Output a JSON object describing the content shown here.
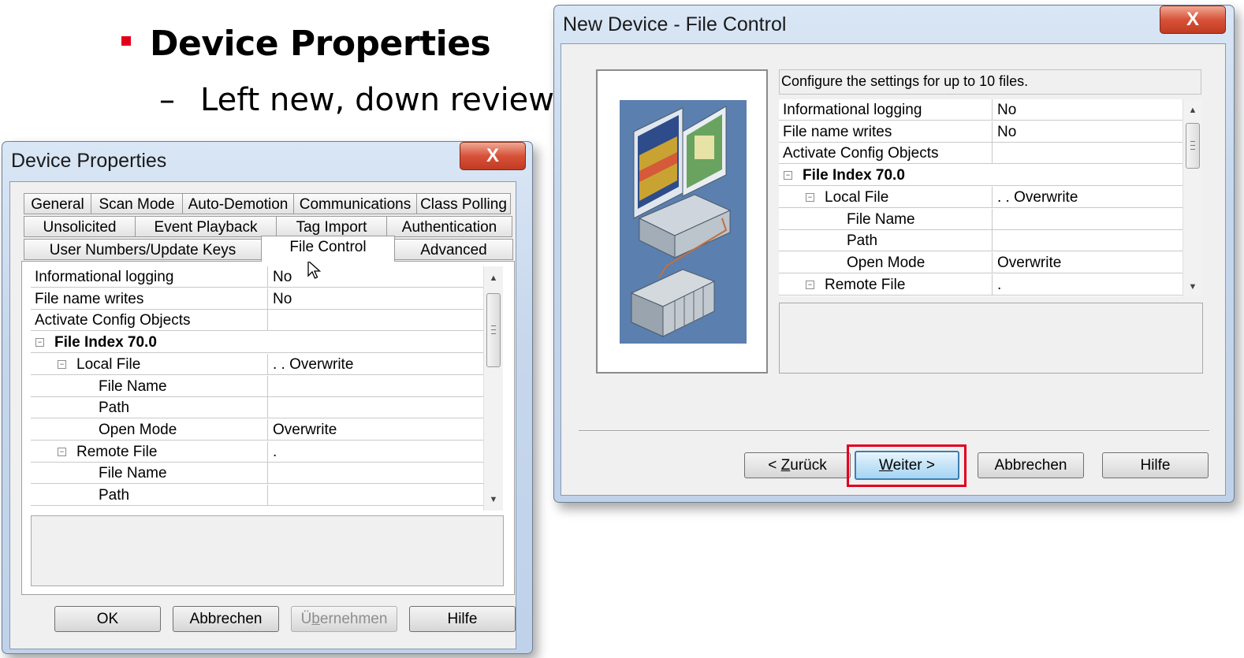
{
  "slide": {
    "title": "Device Properties",
    "dash": "–",
    "subtitle": "Left new, down review"
  },
  "colors": {
    "bullet": "#e3001b",
    "highlight": "#e0001b",
    "close_button": "#d8523a",
    "window_frame": "#c6d7ec"
  },
  "device_properties": {
    "title": "Device Properties",
    "close_glyph": "X",
    "tabs_row1": [
      "General",
      "Scan Mode",
      "Auto-Demotion",
      "Communications",
      "Class Polling"
    ],
    "tabs_row2": [
      "Unsolicited",
      "Event Playback",
      "Tag Import",
      "Authentication"
    ],
    "tabs_row3": [
      "User Numbers/Update Keys",
      "File Control",
      "Advanced"
    ],
    "active_tab": "File Control",
    "rows": [
      {
        "name": "Informational logging",
        "value": "No",
        "level": 0,
        "bold": false,
        "expander": false
      },
      {
        "name": "File name writes",
        "value": "No",
        "level": 0,
        "bold": false,
        "expander": false
      },
      {
        "name": "Activate Config Objects",
        "value": "",
        "level": 0,
        "bold": false,
        "expander": false
      },
      {
        "name": "File Index 70.0",
        "value": "",
        "level": 0,
        "bold": true,
        "expander": true
      },
      {
        "name": "Local File",
        "value": ". . Overwrite",
        "level": 1,
        "bold": false,
        "expander": true
      },
      {
        "name": "File Name",
        "value": "",
        "level": 2,
        "bold": false,
        "expander": false
      },
      {
        "name": "Path",
        "value": "",
        "level": 2,
        "bold": false,
        "expander": false
      },
      {
        "name": "Open Mode",
        "value": "Overwrite",
        "level": 2,
        "bold": false,
        "expander": false
      },
      {
        "name": "Remote File",
        "value": ".",
        "level": 1,
        "bold": false,
        "expander": true
      },
      {
        "name": "File Name",
        "value": "",
        "level": 2,
        "bold": false,
        "expander": false
      },
      {
        "name": "Path",
        "value": "",
        "level": 2,
        "bold": false,
        "expander": false
      }
    ],
    "buttons": {
      "ok": "OK",
      "cancel": "Abbrechen",
      "apply": "Übernehmen",
      "help": "Hilfe"
    }
  },
  "new_device": {
    "title": "New Device - File Control",
    "close_glyph": "X",
    "description": "Configure the settings for up to 10 files.",
    "illustration": "computer-and-plc-illustration",
    "rows": [
      {
        "name": "Informational logging",
        "value": "No",
        "level": 0,
        "bold": false,
        "expander": false
      },
      {
        "name": "File name writes",
        "value": "No",
        "level": 0,
        "bold": false,
        "expander": false
      },
      {
        "name": "Activate Config Objects",
        "value": "",
        "level": 0,
        "bold": false,
        "expander": false
      },
      {
        "name": "File Index 70.0",
        "value": "",
        "level": 0,
        "bold": true,
        "expander": true
      },
      {
        "name": "Local File",
        "value": ". . Overwrite",
        "level": 1,
        "bold": false,
        "expander": true
      },
      {
        "name": "File Name",
        "value": "",
        "level": 2,
        "bold": false,
        "expander": false
      },
      {
        "name": "Path",
        "value": "",
        "level": 2,
        "bold": false,
        "expander": false
      },
      {
        "name": "Open Mode",
        "value": "Overwrite",
        "level": 2,
        "bold": false,
        "expander": false
      },
      {
        "name": "Remote File",
        "value": ".",
        "level": 1,
        "bold": false,
        "expander": true
      }
    ],
    "buttons": {
      "back": "< Zurück",
      "next": "Weiter >",
      "cancel": "Abbrechen",
      "help": "Hilfe"
    }
  }
}
